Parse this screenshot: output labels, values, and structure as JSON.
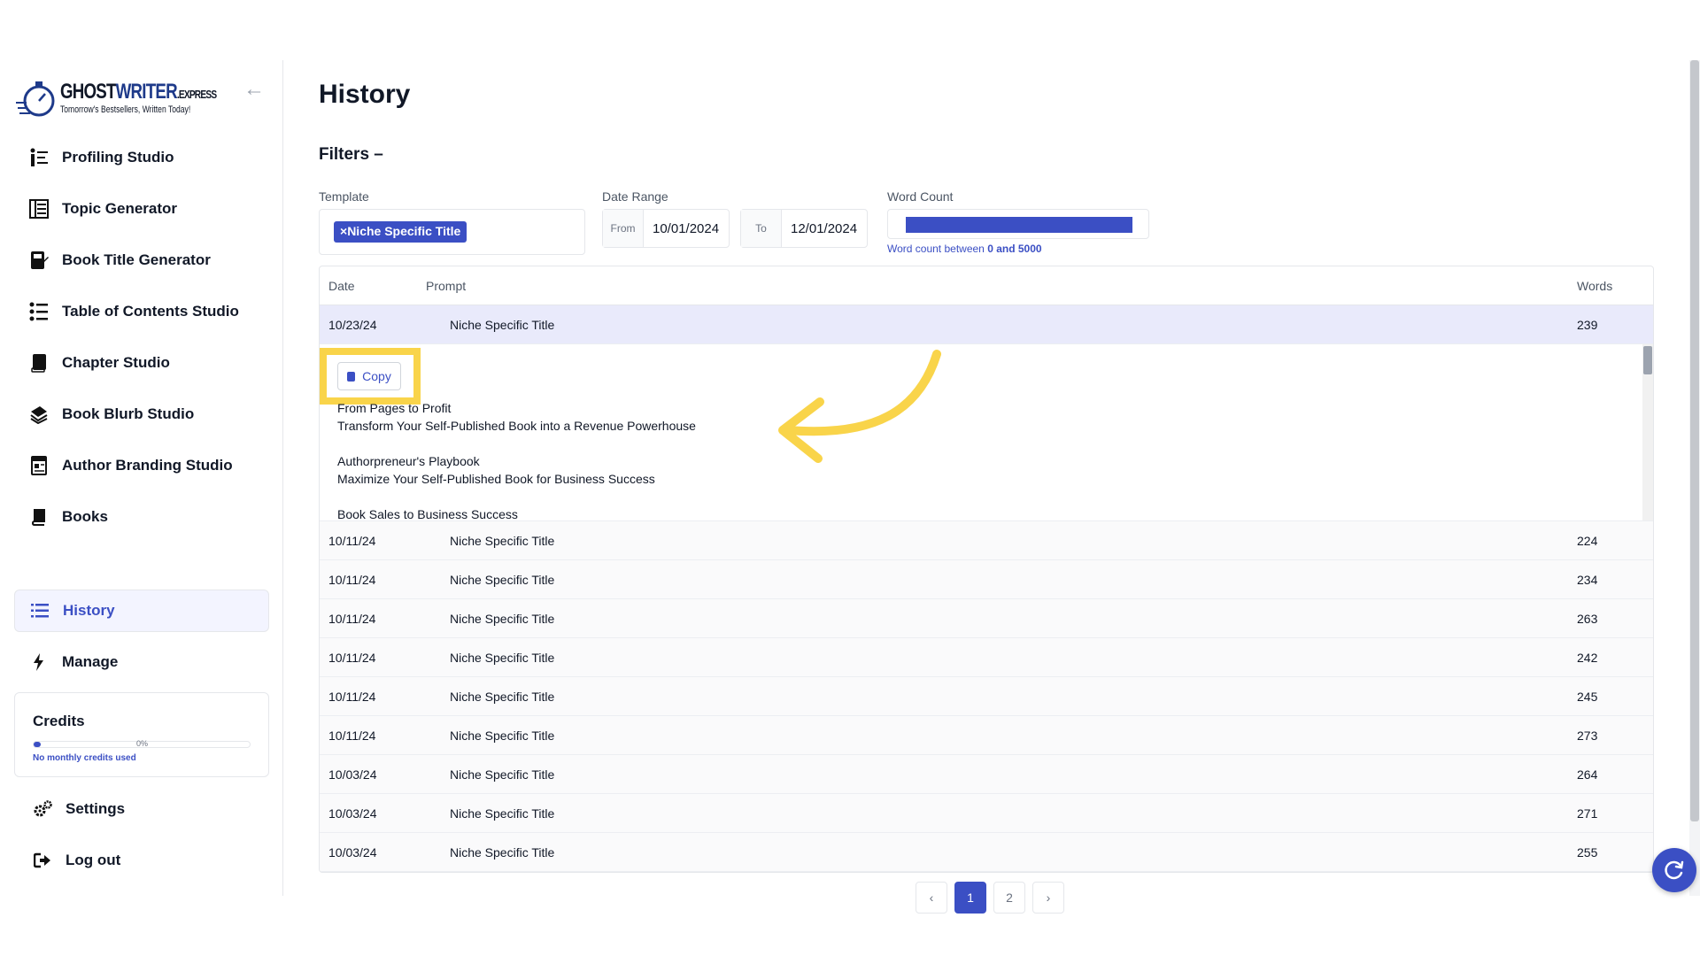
{
  "brand": {
    "name_main": "GHOST",
    "name_accent": "WRITER",
    "name_suffix": ".EXPRESS",
    "tagline": "Tomorrow's Bestsellers, Written Today!"
  },
  "sidebar": {
    "items": [
      {
        "label": "Profiling Studio",
        "icon": "profiling-icon"
      },
      {
        "label": "Topic Generator",
        "icon": "topic-list-icon"
      },
      {
        "label": "Book Title Generator",
        "icon": "book-title-icon"
      },
      {
        "label": "Table of Contents Studio",
        "icon": "toc-list-icon"
      },
      {
        "label": "Chapter Studio",
        "icon": "chapter-icon"
      },
      {
        "label": "Book Blurb Studio",
        "icon": "blurb-icon"
      },
      {
        "label": "Author Branding Studio",
        "icon": "branding-icon"
      },
      {
        "label": "Books",
        "icon": "books-icon"
      },
      {
        "label": "History",
        "icon": "history-list-icon",
        "active": true
      },
      {
        "label": "Manage",
        "icon": "lightning-icon"
      }
    ],
    "credits": {
      "title": "Credits",
      "percent_label": "0%",
      "fraction": 0.0,
      "note": "No monthly credits used"
    },
    "footer_items": [
      {
        "label": "Settings",
        "icon": "gears-icon"
      },
      {
        "label": "Log out",
        "icon": "logout-icon"
      }
    ]
  },
  "main": {
    "title": "History",
    "filters": {
      "title": "Filters –",
      "template_label": "Template",
      "template_chip": "Niche Specific Title",
      "date_range_label": "Date Range",
      "from_prefix": "From",
      "from_value": "10/01/2024",
      "to_prefix": "To",
      "to_value": "12/01/2024",
      "word_count_label": "Word Count",
      "word_count_note_prefix": "Word count between",
      "word_count_note_range": "0 and 5000",
      "word_count_min": 0,
      "word_count_max": 5000
    },
    "table": {
      "headers": {
        "date": "Date",
        "prompt": "Prompt",
        "words": "Words"
      },
      "selected_row": {
        "date": "10/23/24",
        "prompt": "Niche Specific Title",
        "words": "239"
      },
      "expanded": {
        "copy_label": "Copy",
        "lines": [
          "From Pages to Profit",
          "Transform Your Self-Published Book into a Revenue Powerhouse",
          "",
          "Authorpreneur's Playbook",
          "Maximize Your Self-Published Book for Business Success",
          "",
          "Book Sales to Business Success"
        ]
      },
      "rows": [
        {
          "date": "10/11/24",
          "prompt": "Niche Specific Title",
          "words": "224"
        },
        {
          "date": "10/11/24",
          "prompt": "Niche Specific Title",
          "words": "234"
        },
        {
          "date": "10/11/24",
          "prompt": "Niche Specific Title",
          "words": "263"
        },
        {
          "date": "10/11/24",
          "prompt": "Niche Specific Title",
          "words": "242"
        },
        {
          "date": "10/11/24",
          "prompt": "Niche Specific Title",
          "words": "245"
        },
        {
          "date": "10/11/24",
          "prompt": "Niche Specific Title",
          "words": "273"
        },
        {
          "date": "10/03/24",
          "prompt": "Niche Specific Title",
          "words": "264"
        },
        {
          "date": "10/03/24",
          "prompt": "Niche Specific Title",
          "words": "271"
        },
        {
          "date": "10/03/24",
          "prompt": "Niche Specific Title",
          "words": "255"
        }
      ]
    },
    "pagination": {
      "prev": "‹",
      "pages": [
        "1",
        "2"
      ],
      "current": "1",
      "next": "›"
    }
  },
  "colors": {
    "accent": "#3b4fc4",
    "highlight": "#f9d44a"
  }
}
